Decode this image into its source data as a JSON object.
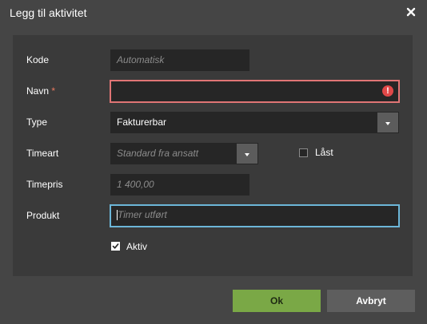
{
  "dialog": {
    "title": "Legg til aktivitet",
    "close_icon": "close-icon"
  },
  "form": {
    "kode": {
      "label": "Kode",
      "placeholder": "Automatisk",
      "value": ""
    },
    "navn": {
      "label": "Navn",
      "required_marker": "*",
      "value": "",
      "error_icon": "alert-circle-icon",
      "error_glyph": "!"
    },
    "type": {
      "label": "Type",
      "value": "Fakturerbar"
    },
    "timeart": {
      "label": "Timeart",
      "placeholder": "Standard fra ansatt",
      "value": ""
    },
    "laast": {
      "label": "Låst",
      "checked": false
    },
    "timepris": {
      "label": "Timepris",
      "placeholder": "1 400,00",
      "value": ""
    },
    "produkt": {
      "label": "Produkt",
      "placeholder": "Timer utført",
      "value": ""
    },
    "aktiv": {
      "label": "Aktiv",
      "checked": true
    }
  },
  "buttons": {
    "ok": "Ok",
    "cancel": "Avbryt"
  },
  "colors": {
    "ok_button": "#7aa846",
    "error_border": "#e07575",
    "focus_border": "#6cb6d8"
  }
}
